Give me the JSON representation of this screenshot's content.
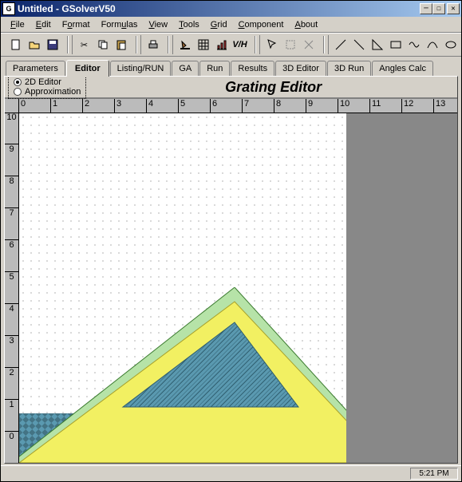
{
  "title": "Untitled - GSolverV50",
  "menus": [
    {
      "label": "File",
      "u": "F"
    },
    {
      "label": "Edit",
      "u": "E"
    },
    {
      "label": "Format",
      "u": "o"
    },
    {
      "label": "Formulas",
      "u": "u"
    },
    {
      "label": "View",
      "u": "V"
    },
    {
      "label": "Tools",
      "u": "T"
    },
    {
      "label": "Grid",
      "u": "G"
    },
    {
      "label": "Component",
      "u": "C"
    },
    {
      "label": "About",
      "u": "A"
    }
  ],
  "toolbar_icons": {
    "new": "new-icon",
    "open": "open-icon",
    "save": "save-icon",
    "cut": "cut-icon",
    "copy": "copy-icon",
    "paste": "paste-icon",
    "print": "print-icon",
    "fill": "fill-icon",
    "grid": "grid-icon",
    "chart": "chart-icon",
    "vh": "V/H",
    "arrow": "arrow-icon",
    "select": "select-icon",
    "snap": "snap-icon",
    "line": "line-icon",
    "diag": "diag-icon",
    "tri": "triangle-icon",
    "rect": "rect-icon",
    "wave": "wave-icon",
    "curve": "curve-icon",
    "ellipse": "ellipse-icon"
  },
  "tabs": [
    {
      "label": "Parameters",
      "active": false
    },
    {
      "label": "Editor",
      "active": true
    },
    {
      "label": "Listing/RUN",
      "active": false
    },
    {
      "label": "GA",
      "active": false
    },
    {
      "label": "Run",
      "active": false
    },
    {
      "label": "Results",
      "active": false
    },
    {
      "label": "3D Editor",
      "active": false
    },
    {
      "label": "3D Run",
      "active": false
    },
    {
      "label": "Angles Calc",
      "active": false
    }
  ],
  "editor": {
    "mode_options": [
      {
        "label": "2D Editor",
        "checked": true
      },
      {
        "label": "Approximation",
        "checked": false
      }
    ],
    "title": "Grating Editor",
    "ruler_x": [
      "0",
      "1",
      "2",
      "3",
      "4",
      "5",
      "6",
      "7",
      "8",
      "9",
      "10",
      "11",
      "12",
      "13"
    ],
    "ruler_y": [
      "0",
      "1",
      "2",
      "3",
      "4",
      "5",
      "6",
      "7",
      "8",
      "9",
      "10"
    ]
  },
  "colors": {
    "water": "#5a99b0",
    "triangle_outer": "#b6e3a8",
    "triangle_mid": "#f2f062",
    "triangle_inner": "#5a99b0"
  },
  "status": {
    "time": "5:21 PM"
  }
}
